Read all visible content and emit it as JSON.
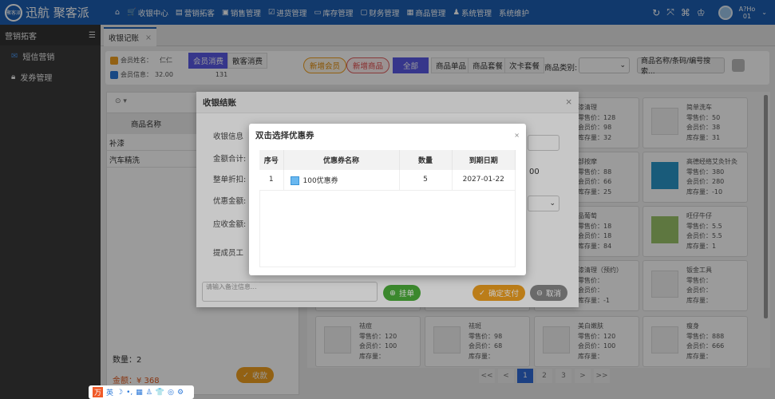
{
  "app": {
    "logo_mark": "聚客派",
    "brand": "迅航 聚客派"
  },
  "nav": [
    {
      "icon": "⌂",
      "label": ""
    },
    {
      "icon": "🛒",
      "label": "收银中心"
    },
    {
      "icon": "▤",
      "label": "营销拓客"
    },
    {
      "icon": "▣",
      "label": "销售管理"
    },
    {
      "icon": "☑",
      "label": "进货管理"
    },
    {
      "icon": "▭",
      "label": "库存管理"
    },
    {
      "icon": "▢",
      "label": "财务管理"
    },
    {
      "icon": "▦",
      "label": "商品管理"
    },
    {
      "icon": "♟",
      "label": "系统管理"
    },
    {
      "icon": "",
      "label": "系统维护"
    }
  ],
  "topright": {
    "user_line1": "A?Ho",
    "user_line2": "01"
  },
  "sidebar": {
    "title": "营销拓客",
    "items": [
      {
        "label": "短信营销"
      },
      {
        "label": "发券管理"
      }
    ]
  },
  "tabs": [
    {
      "label": "收银记账",
      "close": "×"
    }
  ],
  "member": {
    "name_label": "会员姓名：",
    "name": "仁仁",
    "info_label": "会员信息：",
    "balance": "32.00",
    "points": "131",
    "tab_member": "会员消费",
    "tab_guest": "散客消费"
  },
  "toolbar": {
    "add_member": "新增会员",
    "add_product": "新增商品",
    "filters": [
      "全部",
      "商品单品",
      "商品套餐",
      "次卡套餐"
    ],
    "category_label": "商品类别:",
    "search_placeholder": "商品名称/条码/编号搜索..."
  },
  "cart": {
    "col_name": "商品名称",
    "items": [
      "补漆",
      "汽车精洗"
    ],
    "count_label": "数量：",
    "count": "2",
    "total_label": "金额：",
    "total": "¥ 368",
    "checkout": "收款"
  },
  "products": [
    {
      "name": "",
      "retail": "",
      "member": "",
      "stock": ""
    },
    {
      "name": "",
      "retail": "",
      "member": "",
      "stock": ""
    },
    {
      "name": "漆清理",
      "retail": "128",
      "member": "98",
      "stock": "32"
    },
    {
      "name": "简单洗车",
      "retail": "50",
      "member": "38",
      "stock": "31"
    },
    {
      "name": "",
      "retail": "",
      "member": "",
      "stock": ""
    },
    {
      "name": "",
      "retail": "",
      "member": "",
      "stock": ""
    },
    {
      "name": "部按摩",
      "retail": "88",
      "member": "66",
      "stock": "25"
    },
    {
      "name": "高德经络艾灸针灸",
      "retail": "380",
      "member": "280",
      "stock": "-10",
      "photo": "photo"
    },
    {
      "name": "",
      "retail": "",
      "member": "",
      "stock": ""
    },
    {
      "name": "",
      "retail": "",
      "member": "",
      "stock": ""
    },
    {
      "name": "品葡萄",
      "retail": "18",
      "member": "18",
      "stock": "84"
    },
    {
      "name": "旺仔牛仔",
      "retail": "5.5",
      "member": "5.5",
      "stock": "1",
      "photo": "photo2"
    },
    {
      "name": "",
      "retail": "",
      "member": "",
      "stock": ""
    },
    {
      "name": "",
      "retail": "",
      "member": "",
      "stock": ""
    },
    {
      "name": "漆清理（预约）",
      "retail": "",
      "member": "",
      "stock": "-1"
    },
    {
      "name": "钣金工具",
      "retail": "",
      "member": "",
      "stock": ""
    },
    {
      "name": "祛痘",
      "retail": "120",
      "member": "100",
      "stock": ""
    },
    {
      "name": "祛斑",
      "retail": "98",
      "member": "68",
      "stock": ""
    },
    {
      "name": "美白嫩肤",
      "retail": "120",
      "member": "100",
      "stock": ""
    },
    {
      "name": "瘦身",
      "retail": "888",
      "member": "666",
      "stock": ""
    }
  ],
  "product_labels": {
    "retail": "零售价：",
    "member": "会员价：",
    "stock": "库存量："
  },
  "pager": [
    "<<",
    "<",
    "1",
    "2",
    "3",
    ">",
    ">>"
  ],
  "checkout_modal": {
    "title": "收银结账",
    "close": "×",
    "labels": [
      "收银信息",
      "金额合计:",
      "整单折扣:",
      "优惠金额:",
      "应收金额:",
      "提成员工"
    ],
    "partial_value": "00",
    "remark_placeholder": "请输入备注信息...",
    "hold": "挂单",
    "confirm": "确定支付",
    "cancel": "取消"
  },
  "coupon_dialog": {
    "title": "双击选择优惠券",
    "close": "×",
    "columns": [
      "序号",
      "优惠券名称",
      "数量",
      "到期日期"
    ],
    "rows": [
      {
        "no": "1",
        "name": "100优惠券",
        "qty": "5",
        "expiry": "2027-01-22"
      }
    ]
  },
  "ime": {
    "items": [
      "英",
      "☽",
      "•,",
      "▦",
      "♙",
      "👕",
      "◎",
      "⚙"
    ]
  }
}
